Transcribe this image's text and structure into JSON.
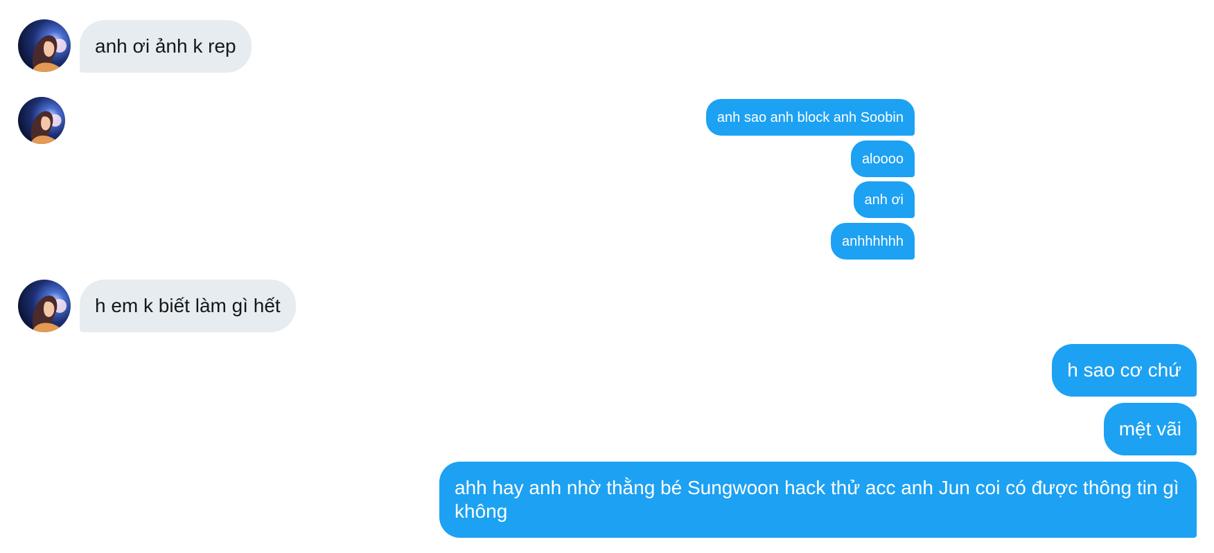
{
  "conversation": {
    "incoming": [
      {
        "text": "anh ơi ảnh k rep"
      },
      {
        "text": "h em k biết làm gì hết"
      }
    ],
    "outgoing": [
      {
        "text": "anh sao anh block anh Soobin"
      },
      {
        "text": "aloooo"
      },
      {
        "text": "anh ơi"
      },
      {
        "text": "anhhhhhh"
      },
      {
        "text": "h sao cơ chứ"
      },
      {
        "text": "mệt vãi"
      },
      {
        "text": "ahh hay anh nhờ thằng bé Sungwoon hack thử acc anh Jun coi có được thông tin gì không"
      }
    ]
  },
  "colors": {
    "incoming_bubble": "#e6ecf0",
    "outgoing_bubble": "#1da1f2",
    "incoming_text": "#14171a",
    "outgoing_text": "#ffffff"
  },
  "icons": {
    "avatar": "contact-avatar"
  }
}
